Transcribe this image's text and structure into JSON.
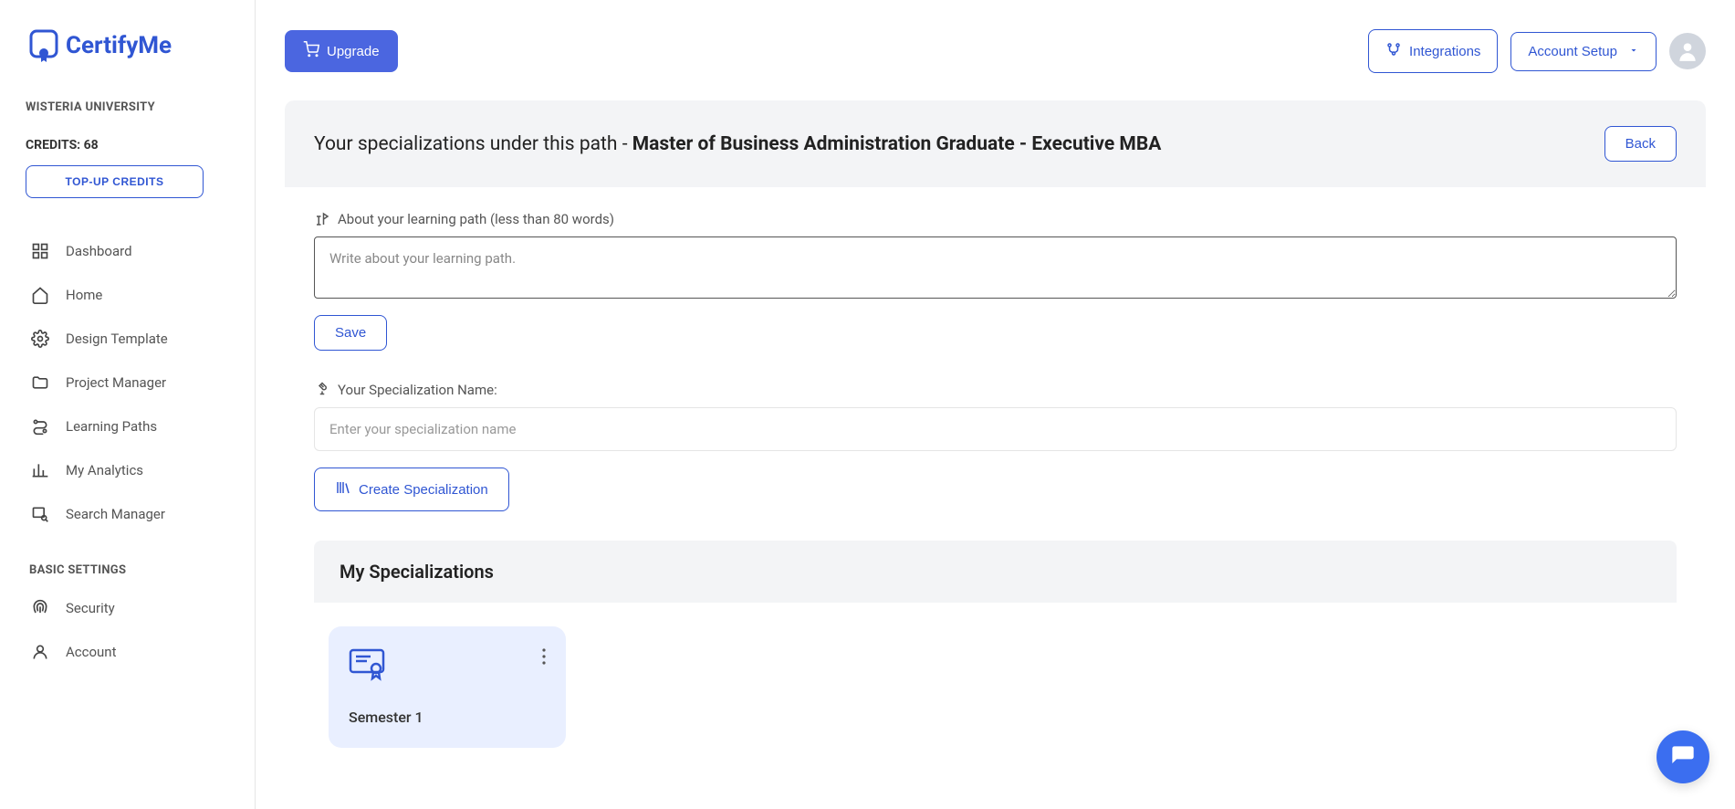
{
  "brand": {
    "name": "CertifyMe"
  },
  "sidebar": {
    "org_name": "WISTERIA UNIVERSITY",
    "credits_label": "CREDITS: 68",
    "topup_label": "TOP-UP CREDITS",
    "nav": [
      {
        "label": "Dashboard"
      },
      {
        "label": "Home"
      },
      {
        "label": "Design Template"
      },
      {
        "label": "Project Manager"
      },
      {
        "label": "Learning Paths"
      },
      {
        "label": "My Analytics"
      },
      {
        "label": "Search Manager"
      }
    ],
    "section_basic": "BASIC SETTINGS",
    "basic_nav": [
      {
        "label": "Security"
      },
      {
        "label": "Account"
      }
    ]
  },
  "topbar": {
    "upgrade": "Upgrade",
    "integrations": "Integrations",
    "account_setup": "Account Setup"
  },
  "panel": {
    "title_prefix": "Your specializations under this path - ",
    "title_bold": "Master of Business Administration Graduate - Executive MBA",
    "back": "Back",
    "about_label": "About your learning path (less than 80 words)",
    "about_placeholder": "Write about your learning path.",
    "save": "Save",
    "spec_name_label": "Your Specialization Name:",
    "spec_name_placeholder": "Enter your specialization name",
    "create_spec": "Create Specialization",
    "my_specs": "My Specializations",
    "cards": [
      {
        "title": "Semester 1"
      }
    ]
  }
}
